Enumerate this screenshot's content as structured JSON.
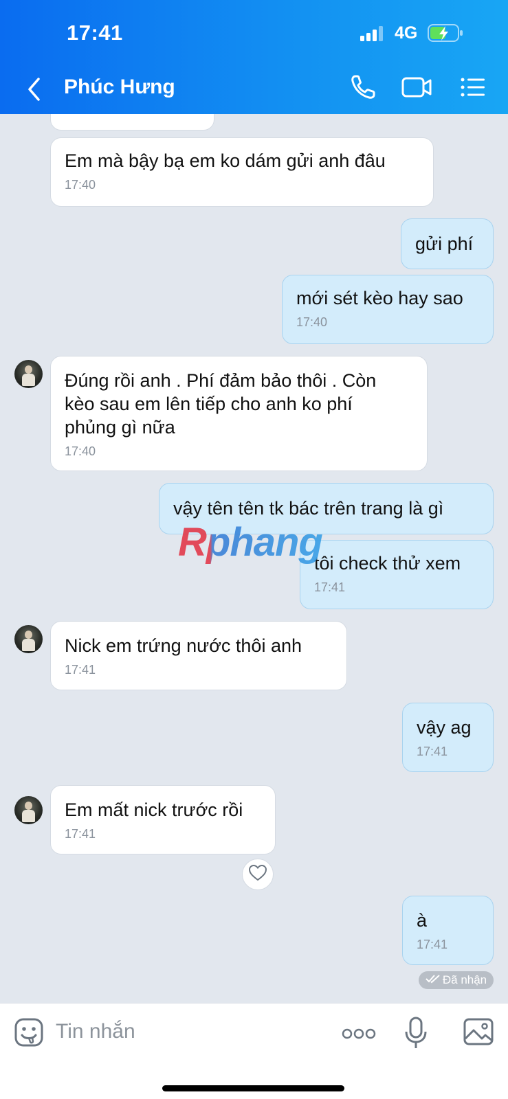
{
  "status_bar": {
    "time": "17:41",
    "network": "4G"
  },
  "header": {
    "contact_name": "Phúc Hưng"
  },
  "messages": [
    {
      "dir": "in",
      "text": "Em mà bậy bạ em ko dám gửi anh đâu",
      "time": "17:40"
    },
    {
      "dir": "out",
      "text": "gửi phí",
      "time": ""
    },
    {
      "dir": "out",
      "text": "mới sét kèo hay sao",
      "time": "17:40"
    },
    {
      "dir": "in",
      "text": "Đúng rồi anh . Phí đảm bảo thôi . Còn\nkèo sau em lên tiếp cho anh ko phí\nphủng gì nữa",
      "time": "17:40"
    },
    {
      "dir": "out",
      "text": "vậy tên tên tk bác trên trang là gì",
      "time": ""
    },
    {
      "dir": "out",
      "text": "tôi check thử xem",
      "time": "17:41"
    },
    {
      "dir": "in",
      "text": "Nick em trứng nước thôi anh",
      "time": "17:41"
    },
    {
      "dir": "out",
      "text": "vậy ag",
      "time": "17:41"
    },
    {
      "dir": "in",
      "text": "Em mất nick trước rồi",
      "time": "17:41"
    },
    {
      "dir": "out",
      "text": "à",
      "time": "17:41"
    }
  ],
  "received_status": "Đã nhận",
  "watermark": "Rphang",
  "composer": {
    "placeholder": "Tin nhắn"
  },
  "icons": [
    "back-icon",
    "phone-icon",
    "video-call-icon",
    "menu-list-icon",
    "emoji-icon",
    "more-icon",
    "mic-icon",
    "gallery-icon",
    "heart-icon"
  ],
  "colors": {
    "header": "#0a6cf0",
    "outgoing_bubble": "#d3ecfb",
    "incoming_bubble": "#ffffff",
    "background": "#e2e7ee"
  }
}
